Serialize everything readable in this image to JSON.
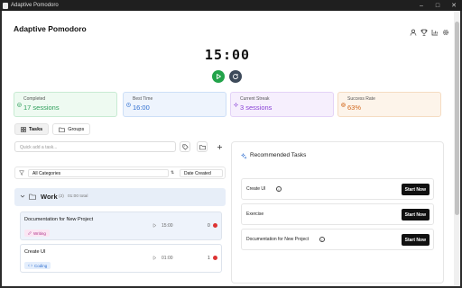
{
  "window": {
    "title": "Adaptive Pomodoro"
  },
  "header": {
    "title": "Adaptive Pomodoro",
    "icons": [
      "user-icon",
      "trophy-icon",
      "chart-icon",
      "gear-icon"
    ]
  },
  "timer": {
    "display": "15:00"
  },
  "controls": {
    "play_icon": "play-icon",
    "reset_icon": "reset-icon"
  },
  "stats": [
    {
      "label": "Completed",
      "value": "17 sessions",
      "icon": "check-circle-icon",
      "color": "#2e9e5a",
      "bg": "#eefaf1",
      "border": "#c8ebd3"
    },
    {
      "label": "Best Time",
      "value": "16:00",
      "icon": "clock-icon",
      "color": "#2f6fd0",
      "bg": "#eef4fd",
      "border": "#cddff7"
    },
    {
      "label": "Current Streak",
      "value": "3 sessions",
      "icon": "sparkle-icon",
      "color": "#8a43d6",
      "bg": "#f6effd",
      "border": "#e4d3f7"
    },
    {
      "label": "Success Rate",
      "value": "63%",
      "icon": "target-icon",
      "color": "#d2691e",
      "bg": "#fdf4ea",
      "border": "#f5dcc2"
    }
  ],
  "tabs": [
    {
      "label": "Tasks",
      "icon": "grid-icon",
      "active": true
    },
    {
      "label": "Groups",
      "icon": "folder-icon",
      "active": false
    }
  ],
  "quick_add": {
    "placeholder": "Quick add a task..."
  },
  "filters": {
    "category": "All Categories",
    "sort_label": "⇅",
    "sort": "Date Created"
  },
  "group": {
    "name": "Work",
    "count": "(2)",
    "meta": "01:00 total"
  },
  "tasks": [
    {
      "name": "Documentation for New Project",
      "tag": "Writing",
      "tag_color": "#b0328a",
      "tag_bg": "#fbe6f3",
      "time": "15:00",
      "count": "0",
      "highlight": true
    },
    {
      "name": "Create UI",
      "tag": "Coding",
      "tag_color": "#2f6fd0",
      "tag_bg": "#e4eefc",
      "time": "01:00",
      "count": "1",
      "highlight": false
    }
  ],
  "recommended": {
    "title": "Recommended Tasks",
    "items": [
      {
        "name": "Create UI",
        "info": true,
        "button": "Start Now"
      },
      {
        "name": "Exercise",
        "info": false,
        "button": "Start Now"
      },
      {
        "name": "Documentation for New Project",
        "info": true,
        "button": "Start Now"
      }
    ]
  }
}
